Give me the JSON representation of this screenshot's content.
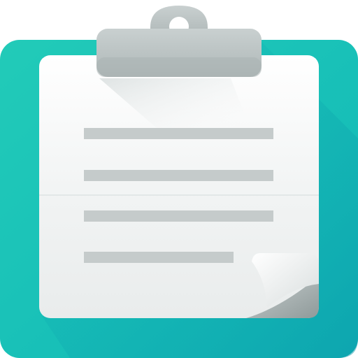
{
  "icon": {
    "name": "clipboard-icon",
    "colors": {
      "board": "#19c4b4",
      "board_dark": "#0fa8b8",
      "board_shadow": "#0b9aa9",
      "paper": "#f3f4f4",
      "paper_light": "#ffffff",
      "paper_shade": "#d9dcdc",
      "line": "#c5cbcb",
      "clip": "#bfc6c6",
      "clip_dark": "#9ea7a7",
      "fold": "#e6e8e8",
      "fold_shadow": "#aab2b2"
    },
    "text_lines_count": 4
  }
}
